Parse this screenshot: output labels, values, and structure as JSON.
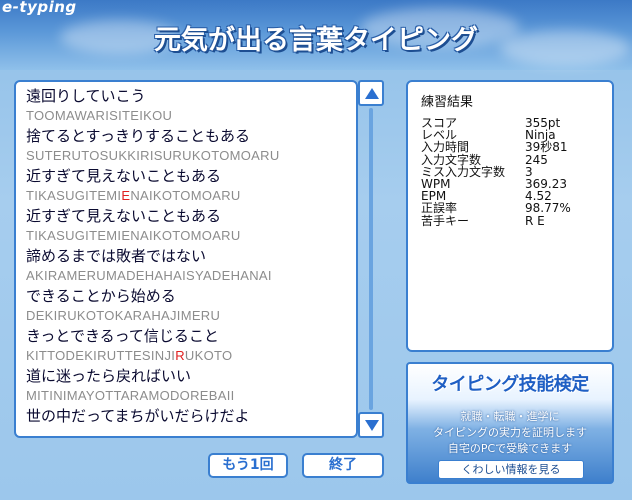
{
  "app": {
    "logo": "e-typing",
    "title": "元気が出る言葉タイピング"
  },
  "lines": [
    {
      "jp": "遠回りしていこう",
      "ro": [
        {
          "t": "TOOMAWARISITEIKOU"
        }
      ]
    },
    {
      "jp": "捨てるとすっきりすることもある",
      "ro": [
        {
          "t": "SUTERUTOSUKKIRISURUKOTOMOARU"
        }
      ]
    },
    {
      "jp": "近すぎて見えないこともある",
      "ro": [
        {
          "t": "TIKASUGITEMI"
        },
        {
          "t": "E",
          "err": true
        },
        {
          "t": "NAIKOTOMOARU"
        }
      ]
    },
    {
      "jp": "近すぎて見えないこともある",
      "ro": [
        {
          "t": "TIKASUGITEMIENAIKOTOMOARU"
        }
      ]
    },
    {
      "jp": "諦めるまでは敗者ではない",
      "ro": [
        {
          "t": "AKIRAMERUMADEHAHAISYADEHANAI"
        }
      ]
    },
    {
      "jp": "できることから始める",
      "ro": [
        {
          "t": "DEKIRUKOTOKARAHAJIMERU"
        }
      ]
    },
    {
      "jp": "きっとできるって信じること",
      "ro": [
        {
          "t": "KITTODEKIRUTTESINJI"
        },
        {
          "t": "R",
          "err": true
        },
        {
          "t": "UKOTO"
        }
      ]
    },
    {
      "jp": "道に迷ったら戻ればいい",
      "ro": [
        {
          "t": "MITINIMAYOTTARAMODOREBAII"
        }
      ]
    },
    {
      "jp": "世の中だってまちがいだらけだよ",
      "ro": []
    }
  ],
  "results": {
    "title": "練習結果",
    "rows": [
      {
        "label": "スコア",
        "value": "355pt"
      },
      {
        "label": "レベル",
        "value": "Ninja"
      },
      {
        "label": "入力時間",
        "value": "39秒81"
      },
      {
        "label": "入力文字数",
        "value": "245"
      },
      {
        "label": "ミス入力文字数",
        "value": "3"
      },
      {
        "label": "WPM",
        "value": "369.23"
      },
      {
        "label": "EPM",
        "value": "4.52"
      },
      {
        "label": "正誤率",
        "value": "98.77%"
      },
      {
        "label": "苦手キー",
        "value": "R E"
      }
    ]
  },
  "ad": {
    "title": "タイピング技能検定",
    "line1": "就職・転職・進学に",
    "line2": "タイピングの実力を証明します",
    "line3": "自宅のPCで受験できます",
    "button": "くわしい情報を見る"
  },
  "buttons": {
    "retry": "もう1回",
    "finish": "終了"
  },
  "colors": {
    "accent": "#3a7fd0",
    "error": "#e02020"
  },
  "icons": {
    "scroll_up": "triangle-up-icon",
    "scroll_down": "triangle-down-icon"
  }
}
